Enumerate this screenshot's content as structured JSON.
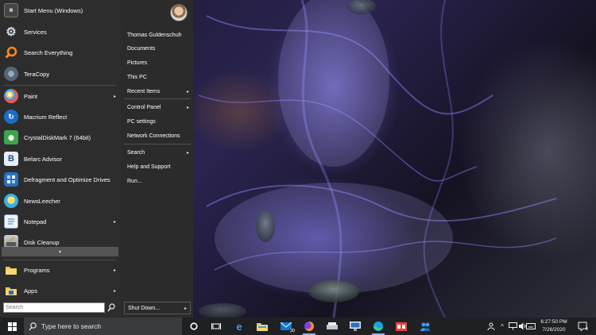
{
  "start_menu": {
    "apps": [
      {
        "label": "Start Menu (Windows)",
        "icon": "start-menu-icon"
      },
      {
        "label": "Services",
        "icon": "gear-icon"
      },
      {
        "label": "Search Everything",
        "icon": "magnifier-icon"
      },
      {
        "label": "TeraCopy",
        "icon": "teracopy-icon"
      },
      {
        "label": "Paint",
        "icon": "paint-palette-icon",
        "has_submenu": true
      },
      {
        "label": "Macrium Reflect",
        "icon": "macrium-icon"
      },
      {
        "label": "CrystalDiskMark 7 (64bit)",
        "icon": "crystaldiskmark-icon"
      },
      {
        "label": "Belarc Advisor",
        "icon": "belarc-icon"
      },
      {
        "label": "Defragment and Optimize Drives",
        "icon": "defrag-icon"
      },
      {
        "label": "NewsLeecher",
        "icon": "newsleecher-icon"
      },
      {
        "label": "Notepad",
        "icon": "notepad-icon",
        "has_submenu": true
      },
      {
        "label": "Disk Cleanup",
        "icon": "disk-cleanup-icon"
      }
    ],
    "expand_arrow": "▾",
    "programs": {
      "label": "Programs",
      "arrow": "▸"
    },
    "apps_folder": {
      "label": "Apps",
      "arrow": "▸"
    },
    "search": {
      "placeholder": "Search",
      "value": ""
    },
    "right": {
      "user": "Thomas Guldenschuh",
      "items": [
        {
          "label": "Documents"
        },
        {
          "label": "Pictures"
        },
        {
          "label": "This PC"
        },
        {
          "label": "Recent Items",
          "arrow": "▸"
        },
        {
          "label": "Control Panel",
          "arrow": "▸"
        },
        {
          "label": "PC settings"
        },
        {
          "label": "Network Connections"
        },
        {
          "label": "Search",
          "arrow": "▸"
        },
        {
          "label": "Help and Support"
        },
        {
          "label": "Run..."
        }
      ],
      "shutdown": {
        "label": "Shut Down...",
        "arrow": "▸"
      }
    }
  },
  "taskbar": {
    "search_placeholder": "Type here to search",
    "mail_badge": "30",
    "clock_time": "6:27:50 PM",
    "clock_date": "7/26/2020",
    "notification_count": "4"
  },
  "colors": {
    "menu_bg": "#2d2d2e",
    "taskbar_bg": "#1f2024",
    "accent_blue": "#1e90ff"
  }
}
